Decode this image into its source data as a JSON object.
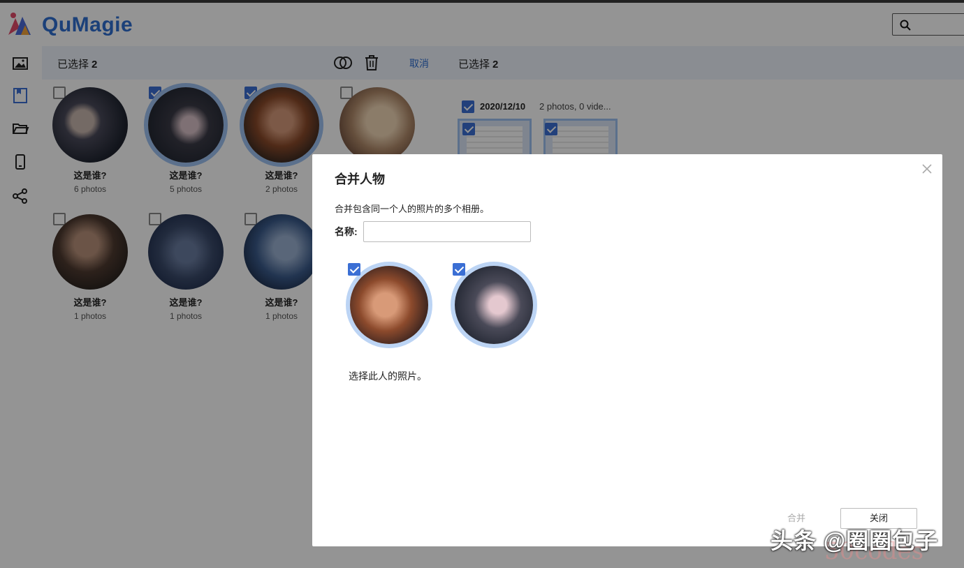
{
  "app": {
    "brand": "QuMagie"
  },
  "search": {
    "placeholder": ""
  },
  "nav": {
    "icons": [
      "photos-icon",
      "albums-icon",
      "folders-icon",
      "device-icon",
      "share-icon"
    ]
  },
  "toolbar": {
    "selected_label": "已选择",
    "selected_count": "2",
    "cancel_label": "取消",
    "selected_label_right": "已选择",
    "selected_count_right": "2"
  },
  "people": [
    {
      "name": "这是谁?",
      "count": "6 photos",
      "checked": false
    },
    {
      "name": "这是谁?",
      "count": "5 photos",
      "checked": true
    },
    {
      "name": "这是谁?",
      "count": "2 photos",
      "checked": true
    },
    {
      "name": "",
      "count": "",
      "checked": false
    },
    {
      "name": "这是谁?",
      "count": "1 photos",
      "checked": false
    },
    {
      "name": "这是谁?",
      "count": "1 photos",
      "checked": false
    },
    {
      "name": "这是谁?",
      "count": "1 photos",
      "checked": false
    }
  ],
  "timeline": {
    "date": "2020/12/10",
    "meta": "2 photos, 0 vide..."
  },
  "dialog": {
    "title": "合并人物",
    "description": "合并包含同一个人的照片的多个相册。",
    "name_label": "名称:",
    "name_value": "",
    "hint": "选择此人的照片。",
    "merge_button": "合并",
    "close_button": "关闭"
  },
  "watermark": {
    "text": "头条 @圈圈包子",
    "text2": "50codes"
  },
  "colors": {
    "accent": "#2f6fd0",
    "checkbox": "#3b6fd4",
    "selection_ring": "#9ec1f1"
  }
}
